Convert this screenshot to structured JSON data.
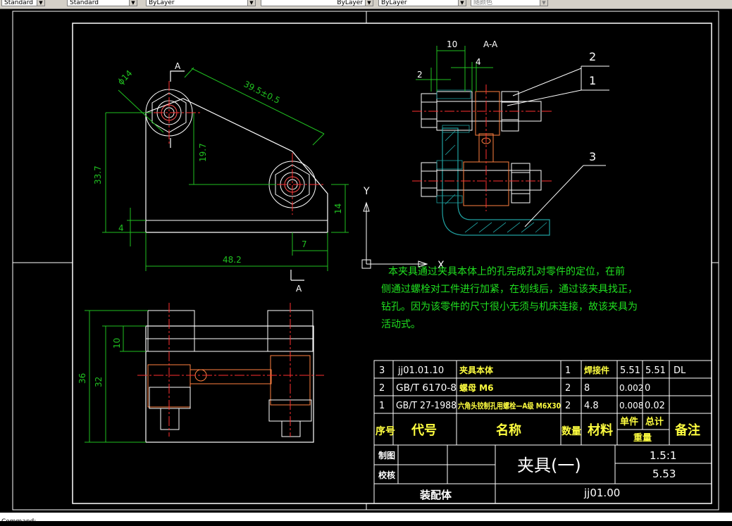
{
  "toolbar": {
    "textstyle": "Standard",
    "layer": "ByLayer",
    "linetype": "ByLayer",
    "lineweight": "ByLayer",
    "plotstyle": "随颜色"
  },
  "section_label": "A-A",
  "section_mark_a": "A",
  "dims": {
    "d10_top": "10",
    "d4_top": "4",
    "d2_top": "2",
    "phi14": "ϕ14",
    "d39": "39.5±0.5",
    "d19": "19.7",
    "d33": "33.7",
    "d14": "14",
    "d4_left": "4",
    "d7": "7",
    "d48": "48.2",
    "d10_plan": "10",
    "d36": "36",
    "d32": "32"
  },
  "balloons": [
    "1",
    "2",
    "3"
  ],
  "ucs": {
    "x": "X",
    "y": "Y"
  },
  "notes": [
    "本夹具通过夹具本体上的孔完成孔对零件的定位，在前",
    "侧通过螺栓对工件进行加紧，在划线后，通过该夹具找正，",
    "钻孔。因为该零件的尺寸很小无须与机床连接，故该夹具为",
    "活动式。"
  ],
  "bom": {
    "rows": [
      {
        "no": "3",
        "code": "jj01.01.10",
        "name": "夹具本体",
        "qty": "1",
        "material": "焊接件",
        "unit": "5.51",
        "total": "5.51",
        "remark": "DL"
      },
      {
        "no": "2",
        "code": "GB/T 6170-8",
        "name": "螺母 M6",
        "qty": "2",
        "material": "8",
        "unit": "0.002",
        "total": "0",
        "remark": ""
      },
      {
        "no": "1",
        "code": "GB/T 27-1988",
        "name": "六角头铰制孔用螺栓—A级 M6X30",
        "qty": "2",
        "material": "4.8",
        "unit": "0.008",
        "total": "0.02",
        "remark": ""
      }
    ],
    "header": {
      "no": "序号",
      "code": "代号",
      "name": "名称",
      "qty": "数量",
      "material": "材料",
      "unit": "单件",
      "total": "总计",
      "weight": "重量",
      "remark": "备注"
    }
  },
  "title_block": {
    "drawn": "制图",
    "checked": "校核",
    "title": "夹具(一)",
    "scale": "1.5:1",
    "weight": "5.53",
    "assembly": "装配体",
    "drawing_no": "jj01.00"
  },
  "command_line": "Command:"
}
